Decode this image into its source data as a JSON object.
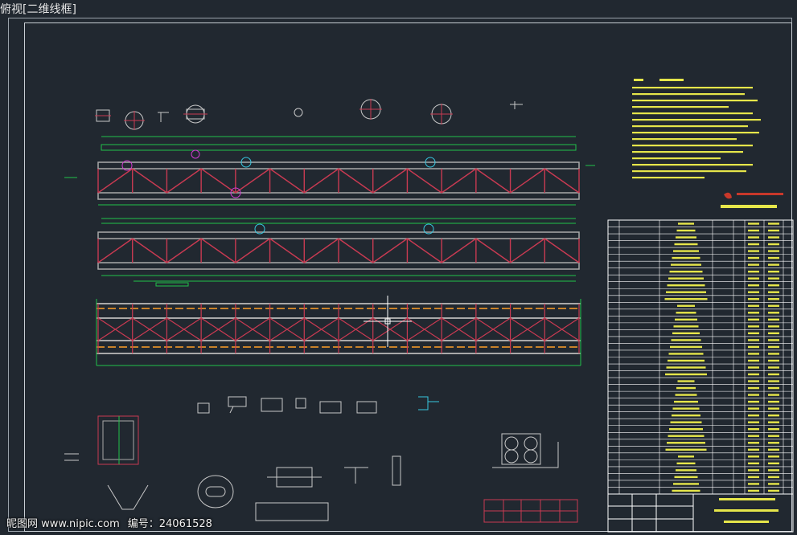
{
  "viewport": {
    "view_label": "俯视",
    "visual_style_label": "[二维线框]"
  },
  "watermark": {
    "site": "昵图网 www.nipic.com",
    "id_label": "编号：",
    "id_value": "24061528"
  },
  "colors": {
    "background": "#212830",
    "frame": "#c8ced4",
    "truss_chord": "#a9a9a9",
    "truss_member": "#c93a52",
    "dimension": "#21c24a",
    "dimension_bright": "#3ee05b",
    "annotation_text": "#e6e64a",
    "highlight_magenta": "#d23ad2",
    "cyan": "#37c7e0",
    "table_lines": "#ffffff",
    "crosshair": "#ffffff"
  },
  "icons": {
    "crosshair": "cad-crosshair-cursor-icon",
    "company_logo": "company-logo-icon"
  }
}
